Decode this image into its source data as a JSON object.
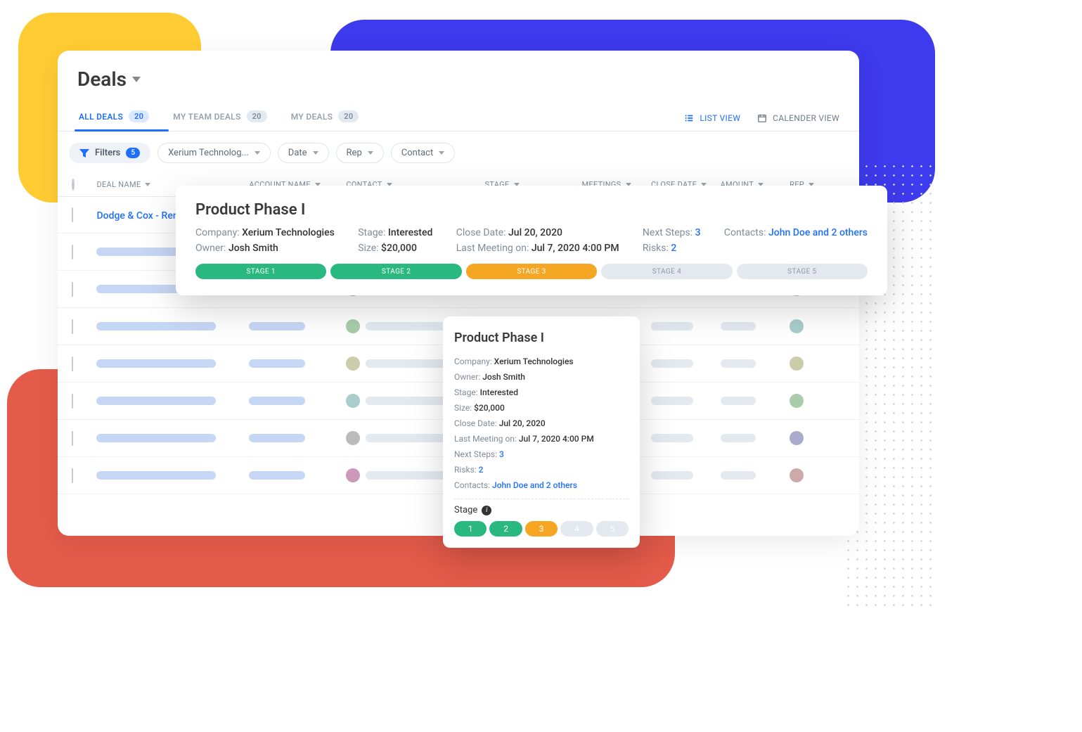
{
  "header": {
    "title": "Deals"
  },
  "tabs": [
    {
      "label": "ALL DEALS",
      "count": "20",
      "active": true
    },
    {
      "label": "MY TEAM DEALS",
      "count": "20",
      "active": false
    },
    {
      "label": "MY DEALS",
      "count": "20",
      "active": false
    }
  ],
  "views": {
    "list": "LIST VIEW",
    "calendar": "CALENDER VIEW"
  },
  "filters": {
    "label": "Filters",
    "count": "5",
    "chips": [
      "Xerium Technolog...",
      "Date",
      "Rep",
      "Contact"
    ]
  },
  "columns": {
    "deal": "DEAL NAME",
    "account": "ACCOUNT NAME",
    "contact": "CONTACT",
    "stage": "STAGE",
    "meetings": "MEETINGS",
    "close": "CLOSE DATE",
    "amount": "AMOUNT",
    "rep": "REP"
  },
  "first_row": {
    "deal": "Dodge & Cox - Rene"
  },
  "pop_wide": {
    "title": "Product Phase I",
    "company_label": "Company:",
    "company": "Xerium Technologies",
    "owner_label": "Owner:",
    "owner": "Josh Smith",
    "stage_label": "Stage:",
    "stage": "Interested",
    "size_label": "Size:",
    "size": "$20,000",
    "close_label": "Close Date:",
    "close": "Jul 20, 2020",
    "last_label": "Last Meeting on:",
    "last": "Jul 7, 2020 4:00 PM",
    "next_label": "Next Steps:",
    "next": "3",
    "risks_label": "Risks:",
    "risks": "2",
    "contacts_label": "Contacts:",
    "contacts": "John Doe and 2 others",
    "stages": [
      "STAGE 1",
      "STAGE 2",
      "STAGE 3",
      "STAGE 4",
      "STAGE 5"
    ]
  },
  "pop_small": {
    "title": "Product Phase I",
    "lines": {
      "company_label": "Company:",
      "company": "Xerium Technologies",
      "owner_label": "Owner:",
      "owner": "Josh Smith",
      "stage_label": "Stage:",
      "stage": "Interested",
      "size_label": "Size:",
      "size": "$20,000",
      "close_label": "Close Date:",
      "close": "Jul 20, 2020",
      "last_label": "Last Meeting on:",
      "last": "Jul 7, 2020 4:00 PM",
      "next_label": "Next Steps:",
      "next": "3",
      "risks_label": "Risks:",
      "risks": "2",
      "contacts_label": "Contacts:",
      "contacts": "John Doe and 2 others"
    },
    "stage_heading": "Stage",
    "stages": [
      "1",
      "2",
      "3",
      "4",
      "5"
    ]
  }
}
